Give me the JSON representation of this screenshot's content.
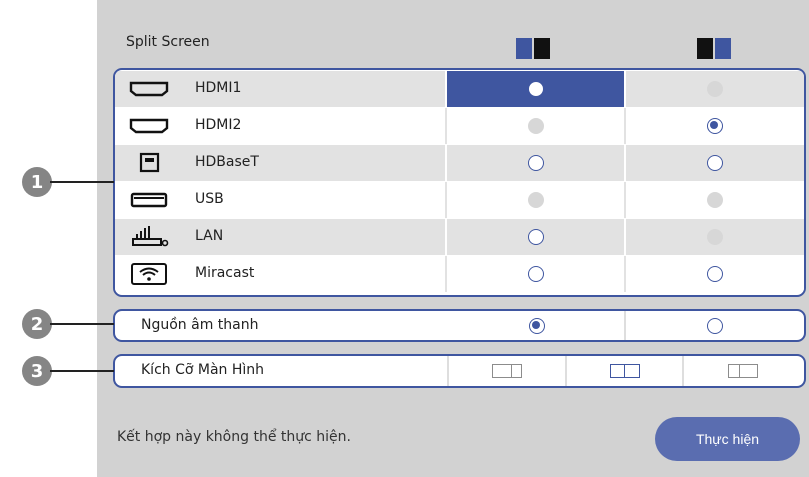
{
  "header": {
    "title": "Split Screen",
    "layout_left_icon": "split-left-active-icon",
    "layout_right_icon": "split-right-active-icon"
  },
  "colors": {
    "accent": "#3f56a0",
    "panel": "#d2d2d2",
    "button": "#5a6db0"
  },
  "sources": [
    {
      "label": "HDMI1",
      "icon": "hdmi-icon",
      "left": "selected",
      "right": "disabled"
    },
    {
      "label": "HDMI2",
      "icon": "hdmi-icon",
      "left": "disabled",
      "right": "checked"
    },
    {
      "label": "HDBaseT",
      "icon": "hdbaset-icon",
      "left": "empty",
      "right": "empty"
    },
    {
      "label": "USB",
      "icon": "usb-icon",
      "left": "disabled",
      "right": "disabled"
    },
    {
      "label": "LAN",
      "icon": "lan-icon",
      "left": "empty",
      "right": "disabled"
    },
    {
      "label": "Miracast",
      "icon": "wifi-icon",
      "left": "empty",
      "right": "empty"
    }
  ],
  "audio": {
    "label": "Nguồn âm thanh",
    "left": "checked",
    "right": "empty"
  },
  "screen_size": {
    "label": "Kích Cỡ Màn Hình",
    "selected_index": 1
  },
  "callouts": [
    "1",
    "2",
    "3"
  ],
  "footer": {
    "status": "Kết hợp này không thể thực hiện.",
    "execute_label": "Thực hiện"
  }
}
